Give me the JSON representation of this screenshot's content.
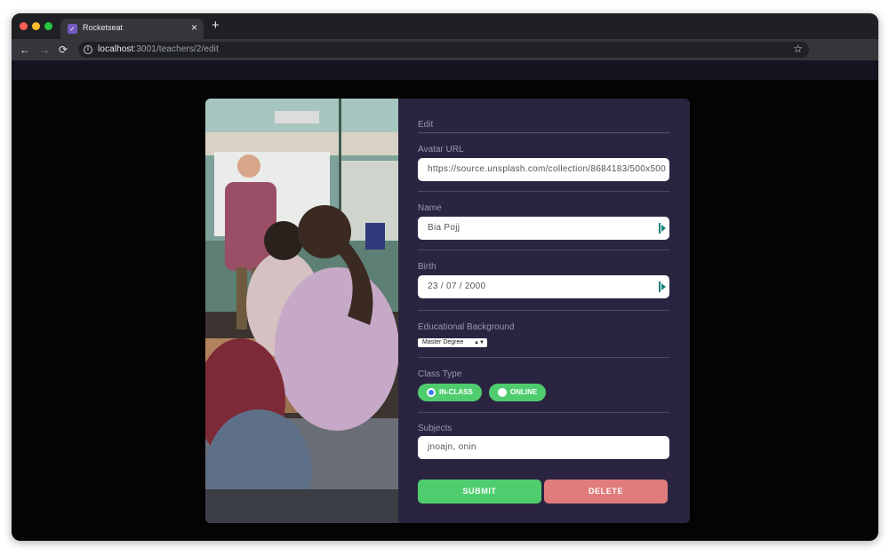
{
  "browser": {
    "tab_title": "Rocketseat",
    "tab_close": "×",
    "new_tab": "+",
    "url_host": "localhost",
    "url_path": ":3001/teachers/2/edit",
    "back": "←",
    "forward": "→",
    "reload": "⟳",
    "star": "☆",
    "info": "i"
  },
  "form": {
    "legend": "Edit",
    "avatar": {
      "label": "Avatar URL",
      "value": "https://source.unsplash.com/collection/8684183/500x500"
    },
    "name": {
      "label": "Name",
      "value": "Bia Pojj"
    },
    "birth": {
      "label": "Birth",
      "value": "23 / 07 / 2000"
    },
    "education": {
      "label": "Educational Background",
      "selected": "Master Degree"
    },
    "class_type": {
      "label": "Class Type",
      "options": [
        {
          "label": "IN-CLASS",
          "checked": true
        },
        {
          "label": "ONLINE",
          "checked": false
        }
      ]
    },
    "subjects": {
      "label": "Subjects",
      "value": "jnoajn, onin"
    },
    "submit_label": "SUBMIT",
    "delete_label": "DELETE"
  },
  "colors": {
    "form_bg": "#2b2440",
    "green": "#4fcd6e",
    "red": "#e07c7c",
    "brand": "#7159c1"
  }
}
